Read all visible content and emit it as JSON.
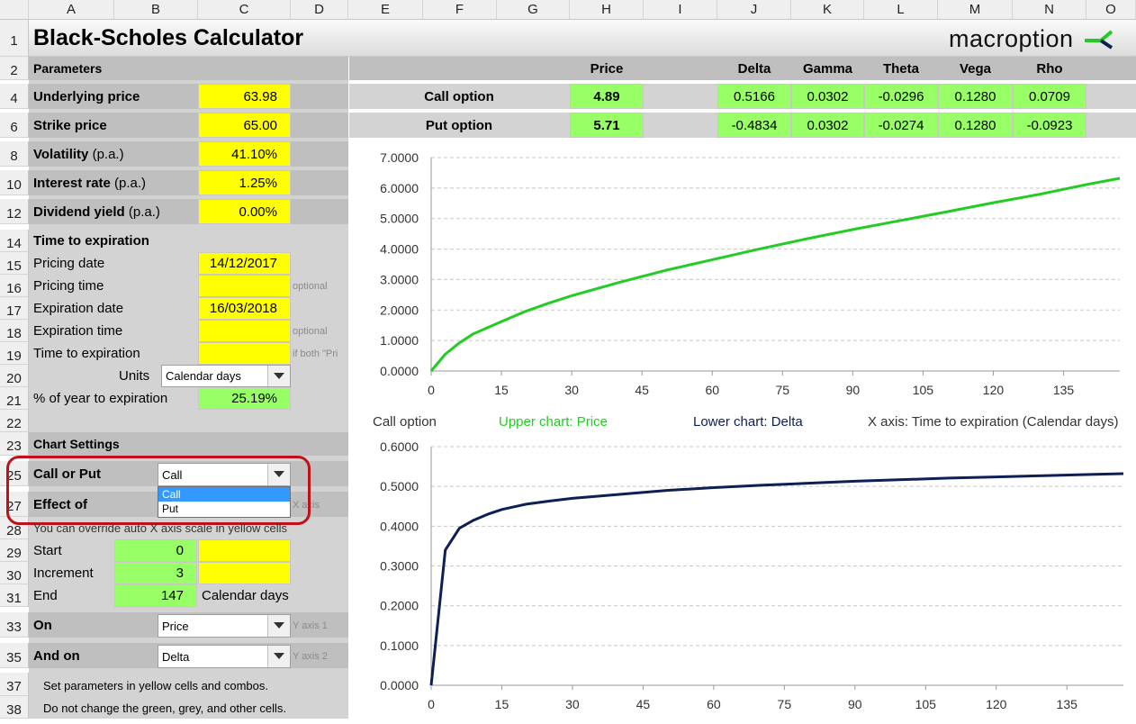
{
  "columns": [
    "A",
    "B",
    "C",
    "D",
    "E",
    "F",
    "G",
    "H",
    "I",
    "J",
    "K",
    "L",
    "M",
    "N",
    "O"
  ],
  "rows": [
    "1",
    "2",
    "4",
    "6",
    "8",
    "10",
    "12",
    "14",
    "15",
    "16",
    "17",
    "18",
    "19",
    "20",
    "21",
    "22",
    "23",
    "25",
    "27",
    "28",
    "29",
    "30",
    "31",
    "33",
    "35",
    "37",
    "38"
  ],
  "title": "Black-Scholes Calculator",
  "logo": "macroption",
  "params": {
    "header": "Parameters",
    "underlying_label": "Underlying price",
    "underlying_value": "63.98",
    "strike_label": "Strike price",
    "strike_value": "65.00",
    "volatility_label": "Volatility",
    "volatility_suffix": "(p.a.)",
    "volatility_value": "41.10%",
    "interest_label": "Interest rate",
    "interest_suffix": "(p.a.)",
    "interest_value": "1.25%",
    "dividend_label": "Dividend yield",
    "dividend_suffix": "(p.a.)",
    "dividend_value": "0.00%"
  },
  "time": {
    "header": "Time to expiration",
    "pricing_date_label": "Pricing date",
    "pricing_date_value": "14/12/2017",
    "pricing_time_label": "Pricing time",
    "pricing_time_note": "optional",
    "expiration_date_label": "Expiration date",
    "expiration_date_value": "16/03/2018",
    "expiration_time_label": "Expiration time",
    "expiration_time_note": "optional",
    "tte_label": "Time to expiration",
    "tte_note": "if both \"Pri",
    "units_label": "Units",
    "units_value": "Calendar days",
    "pct_label": "% of year to expiration",
    "pct_value": "25.19%"
  },
  "chart_settings": {
    "header": "Chart Settings",
    "call_put_label": "Call or Put",
    "call_put_value": "Call",
    "dropdown_options": [
      "Call",
      "Put"
    ],
    "effect_label": "Effect of",
    "x_axis_note": "X axis",
    "override_note": "You can override auto X axis scale in yellow cells",
    "start_label": "Start",
    "start_value": "0",
    "increment_label": "Increment",
    "increment_value": "3",
    "end_label": "End",
    "end_value": "147",
    "end_unit": "Calendar days",
    "on_label": "On",
    "on_value": "Price",
    "y1_note": "Y axis 1",
    "andon_label": "And on",
    "andon_value": "Delta",
    "y2_note": "Y axis 2",
    "help1": "Set parameters in yellow cells and combos.",
    "help2": "Do not change the green, grey, and other cells."
  },
  "results": {
    "headers": [
      "Price",
      "Delta",
      "Gamma",
      "Theta",
      "Vega",
      "Rho"
    ],
    "call_label": "Call option",
    "call_values": [
      "4.89",
      "0.5166",
      "0.0302",
      "-0.0296",
      "0.1280",
      "0.0709"
    ],
    "put_label": "Put option",
    "put_values": [
      "5.71",
      "-0.4834",
      "0.0302",
      "-0.0274",
      "0.1280",
      "-0.0923"
    ]
  },
  "chart_legend": {
    "option": "Call option",
    "upper": "Upper chart: Price",
    "lower": "Lower chart: Delta",
    "xaxis": "X axis: Time to expiration (Calendar days)"
  },
  "colors": {
    "upper_line": "#22cc22",
    "lower_line": "#0d1f55",
    "yellow": "#ffff00",
    "green": "#99ff66"
  },
  "chart_data": [
    {
      "type": "line",
      "title": "",
      "xlabel": "",
      "ylabel": "",
      "xlim": [
        0,
        147
      ],
      "ylim": [
        0,
        7
      ],
      "xticks": [
        0,
        15,
        30,
        45,
        60,
        75,
        90,
        105,
        120,
        135
      ],
      "yticks": [
        "0.0000",
        "1.0000",
        "2.0000",
        "3.0000",
        "4.0000",
        "5.0000",
        "6.0000",
        "7.0000"
      ],
      "grid": true,
      "series": [
        {
          "x": [
            0,
            3,
            6,
            9,
            15,
            20,
            25,
            30,
            40,
            50,
            60,
            70,
            80,
            90,
            100,
            110,
            120,
            130,
            140,
            147
          ],
          "y": [
            0.0,
            0.55,
            0.92,
            1.22,
            1.62,
            1.95,
            2.22,
            2.47,
            2.9,
            3.3,
            3.65,
            4.0,
            4.33,
            4.64,
            4.93,
            5.22,
            5.52,
            5.8,
            6.12,
            6.32
          ]
        }
      ]
    },
    {
      "type": "line",
      "title": "",
      "xlabel": "",
      "ylabel": "",
      "xlim": [
        0,
        147
      ],
      "ylim": [
        0,
        0.6
      ],
      "xticks": [
        0,
        15,
        30,
        45,
        60,
        75,
        90,
        105,
        120,
        135
      ],
      "yticks": [
        "0.0000",
        "0.1000",
        "0.2000",
        "0.3000",
        "0.4000",
        "0.5000",
        "0.6000"
      ],
      "grid": true,
      "series": [
        {
          "x": [
            0,
            3,
            6,
            9,
            12,
            15,
            20,
            25,
            30,
            40,
            50,
            60,
            70,
            80,
            90,
            100,
            110,
            120,
            130,
            140,
            147
          ],
          "y": [
            0.0,
            0.34,
            0.395,
            0.415,
            0.43,
            0.442,
            0.455,
            0.463,
            0.47,
            0.48,
            0.49,
            0.497,
            0.503,
            0.508,
            0.513,
            0.517,
            0.521,
            0.524,
            0.527,
            0.53,
            0.532
          ]
        }
      ]
    }
  ]
}
